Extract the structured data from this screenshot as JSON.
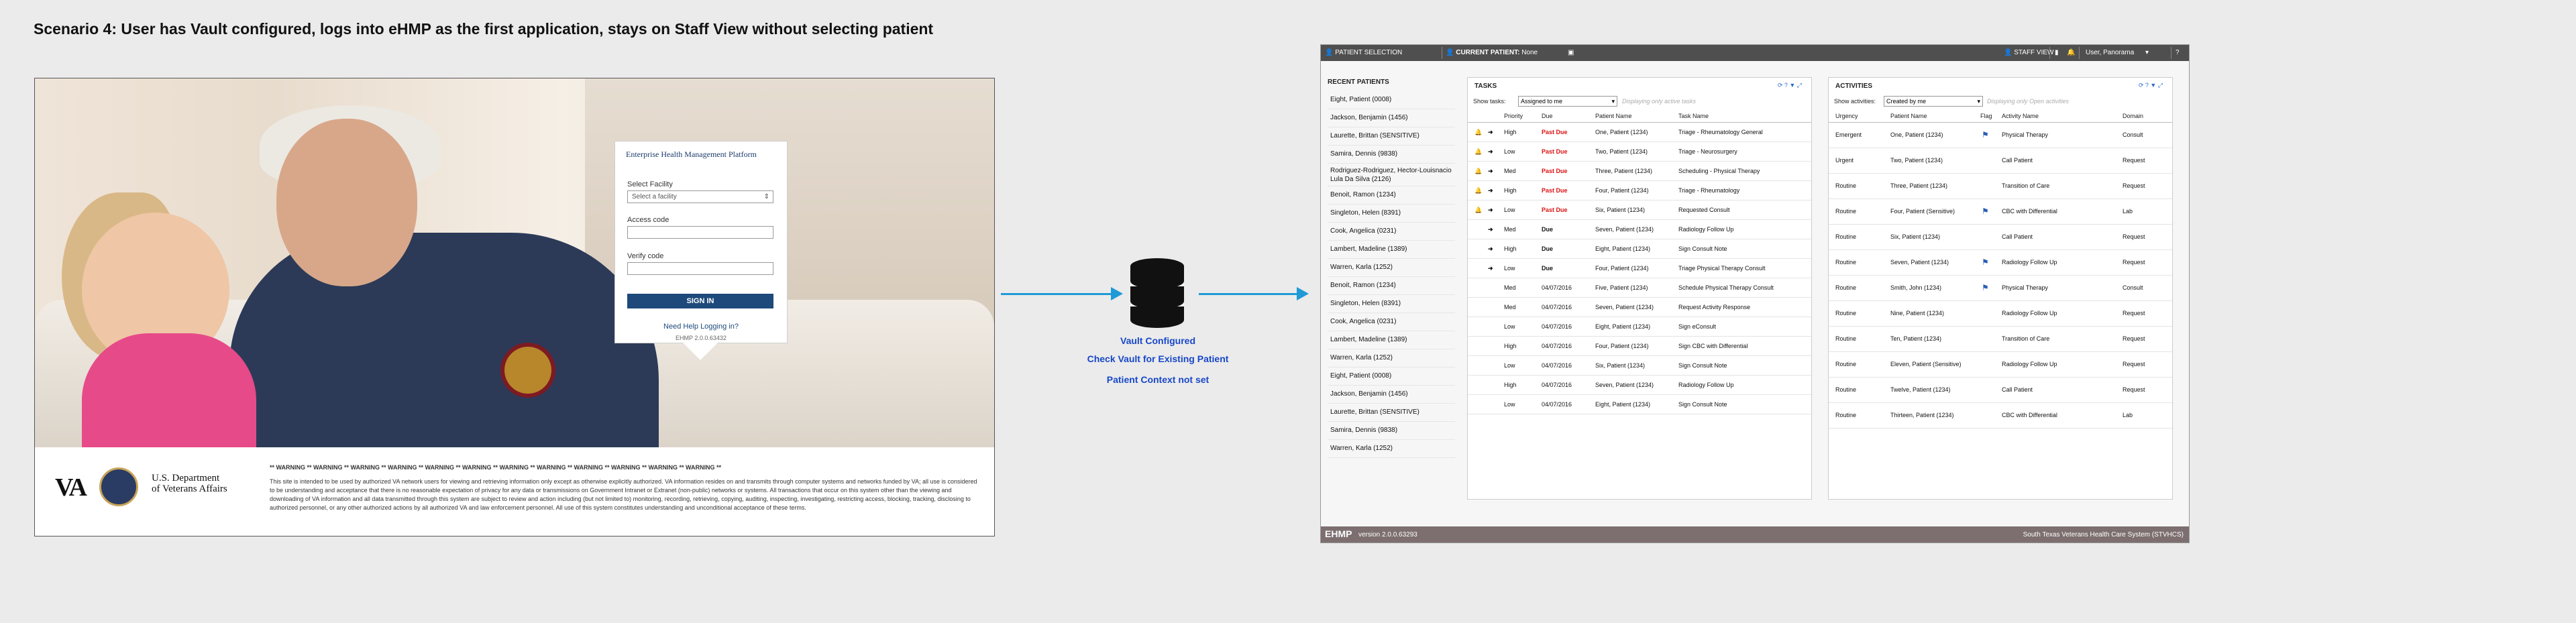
{
  "title": "Scenario 4: User has Vault configured, logs into eHMP as the first application, stays on Staff View without selecting patient",
  "login": {
    "platform_title": "Enterprise Health Management Platform",
    "select_facility_label": "Select Facility",
    "select_facility_value": "Select a facility",
    "access_code_label": "Access code",
    "verify_code_label": "Verify code",
    "sign_in": "SIGN IN",
    "help": "Need Help Logging in?",
    "version": "EHMP 2.0.0.63432",
    "va_logo": "VA",
    "dept_line1": "U.S. Department",
    "dept_line2": "of Veterans Affairs",
    "warning_header": "** WARNING ** WARNING ** WARNING ** WARNING ** WARNING ** WARNING ** WARNING ** WARNING ** WARNING ** WARNING ** WARNING ** WARNING **",
    "warning_text": "This site is intended to be used by authorized VA network users for viewing and retrieving information only except as otherwise explicitly authorized. VA information resides on and transmits through computer systems and networks funded by VA; all use is considered to be understanding and acceptance that there is no reasonable expectation of privacy for any data or transmissions on Government Intranet or Extranet (non-public) networks or systems. All transactions that occur on this system other than the viewing and downloading of VA information and all data transmitted through this system are subject to review and action including (but not limited to) monitoring, recording, retrieving, copying, auditing, inspecting, investigating, restricting access, blocking, tracking, disclosing to authorized personnel, or any other authorized actions by all authorized VA and law enforcement personnel. All use of this system constitutes understanding and unconditional acceptance of these terms."
  },
  "flow": {
    "line1": "Vault Configured",
    "line2": "Check Vault for Existing Patient",
    "line3": "Patient Context not set"
  },
  "app": {
    "patient_selection": "PATIENT SELECTION",
    "current_patient_label": "CURRENT PATIENT:",
    "current_patient_value": "None",
    "staff_view": "STAFF VIEW",
    "user": "User, Panorama",
    "footer_brand": "EHMP",
    "footer_version": "version 2.0.0.63293",
    "footer_site": "South Texas Veterans Health Care System (STVHCS)",
    "recent_title": "RECENT PATIENTS",
    "recent_patients": [
      "Eight, Patient (0008)",
      "Jackson, Benjamin (1456)",
      "Laurette, Brittan (SENSITIVE)",
      "Samira, Dennis (9838)",
      "Rodriguez-Rodriguez, Hector-Louisnacio Lula Da Silva (2126)",
      "Benoit, Ramon (1234)",
      "Singleton, Helen (8391)",
      "Cook, Angelica (0231)",
      "Lambert, Madeline (1389)",
      "Warren, Karla (1252)",
      "Benoit, Ramon (1234)",
      "Singleton, Helen (8391)",
      "Cook, Angelica (0231)",
      "Lambert, Madeline (1389)",
      "Warren, Karla (1252)",
      "Eight, Patient (0008)",
      "Jackson, Benjamin (1456)",
      "Laurette, Brittan (SENSITIVE)",
      "Samira, Dennis (9838)",
      "Warren, Karla (1252)"
    ],
    "tasks": {
      "title": "TASKS",
      "show_label": "Show tasks:",
      "show_value": "Assigned to me",
      "hint": "Displaying only active tasks",
      "columns": [
        "Priority",
        "Due",
        "Patient Name",
        "Task Name"
      ],
      "rows": [
        {
          "bell": true,
          "arrow": true,
          "priority": "High",
          "due": "Past Due",
          "due_style": "past",
          "patient": "One, Patient (1234)",
          "task": "Triage - Rheumatology General"
        },
        {
          "bell": true,
          "arrow": true,
          "priority": "Low",
          "due": "Past Due",
          "due_style": "past",
          "patient": "Two, Patient (1234)",
          "task": "Triage - Neurosurgery"
        },
        {
          "bell": true,
          "arrow": true,
          "priority": "Med",
          "due": "Past Due",
          "due_style": "past",
          "patient": "Three, Patient (1234)",
          "task": "Scheduling - Physical Therapy"
        },
        {
          "bell": true,
          "arrow": true,
          "priority": "High",
          "due": "Past Due",
          "due_style": "past",
          "patient": "Four, Patient (1234)",
          "task": "Triage - Rheumatology"
        },
        {
          "bell": true,
          "arrow": true,
          "priority": "Low",
          "due": "Past Due",
          "due_style": "past",
          "patient": "Six, Patient (1234)",
          "task": "Requested Consult"
        },
        {
          "bell": false,
          "arrow": true,
          "priority": "Med",
          "due": "Due",
          "due_style": "due",
          "patient": "Seven, Patient (1234)",
          "task": "Radiology Follow Up"
        },
        {
          "bell": false,
          "arrow": true,
          "priority": "High",
          "due": "Due",
          "due_style": "due",
          "patient": "Eight, Patient (1234)",
          "task": "Sign Consult Note"
        },
        {
          "bell": false,
          "arrow": true,
          "priority": "Low",
          "due": "Due",
          "due_style": "due",
          "patient": "Four, Patient (1234)",
          "task": "Triage Physical Therapy Consult"
        },
        {
          "bell": false,
          "arrow": false,
          "priority": "Med",
          "due": "04/07/2016",
          "due_style": "",
          "patient": "Five, Patient (1234)",
          "task": "Schedule Physical Therapy Consult"
        },
        {
          "bell": false,
          "arrow": false,
          "priority": "Med",
          "due": "04/07/2016",
          "due_style": "",
          "patient": "Seven, Patient (1234)",
          "task": "Request Activity Response"
        },
        {
          "bell": false,
          "arrow": false,
          "priority": "Low",
          "due": "04/07/2016",
          "due_style": "",
          "patient": "Eight, Patient (1234)",
          "task": "Sign eConsult"
        },
        {
          "bell": false,
          "arrow": false,
          "priority": "High",
          "due": "04/07/2016",
          "due_style": "",
          "patient": "Four, Patient (1234)",
          "task": "Sign CBC with Differential"
        },
        {
          "bell": false,
          "arrow": false,
          "priority": "Low",
          "due": "04/07/2016",
          "due_style": "",
          "patient": "Six, Patient (1234)",
          "task": "Sign Consult Note"
        },
        {
          "bell": false,
          "arrow": false,
          "priority": "High",
          "due": "04/07/2016",
          "due_style": "",
          "patient": "Seven, Patient (1234)",
          "task": "Radiology Follow Up"
        },
        {
          "bell": false,
          "arrow": false,
          "priority": "Low",
          "due": "04/07/2016",
          "due_style": "",
          "patient": "Eight, Patient (1234)",
          "task": "Sign Consult Note"
        }
      ]
    },
    "activities": {
      "title": "ACTIVITIES",
      "show_label": "Show activities:",
      "show_value": "Created by me",
      "hint": "Displaying only Open activities",
      "columns": [
        "Urgency",
        "Patient Name",
        "Flag",
        "Activity Name",
        "Domain"
      ],
      "rows": [
        {
          "urgency": "Emergent",
          "patient": "One, Patient (1234)",
          "flag": true,
          "activity": "Physical Therapy",
          "domain": "Consult"
        },
        {
          "urgency": "Urgent",
          "patient": "Two, Patient (1234)",
          "flag": false,
          "activity": "Call Patient",
          "domain": "Request"
        },
        {
          "urgency": "Routine",
          "patient": "Three, Patient (1234)",
          "flag": false,
          "activity": "Transition of Care",
          "domain": "Request"
        },
        {
          "urgency": "Routine",
          "patient": "Four, Patient (Sensitive)",
          "flag": true,
          "activity": "CBC with Differential",
          "domain": "Lab"
        },
        {
          "urgency": "Routine",
          "patient": "Six, Patient (1234)",
          "flag": false,
          "activity": "Call Patient",
          "domain": "Request"
        },
        {
          "urgency": "Routine",
          "patient": "Seven, Patient (1234)",
          "flag": true,
          "activity": "Radiology Follow Up",
          "domain": "Request"
        },
        {
          "urgency": "Routine",
          "patient": "Smith, John (1234)",
          "flag": true,
          "activity": "Physical Therapy",
          "domain": "Consult"
        },
        {
          "urgency": "Routine",
          "patient": "Nine, Patient (1234)",
          "flag": false,
          "activity": "Radiology Follow Up",
          "domain": "Request"
        },
        {
          "urgency": "Routine",
          "patient": "Ten, Patient (1234)",
          "flag": false,
          "activity": "Transition of Care",
          "domain": "Request"
        },
        {
          "urgency": "Routine",
          "patient": "Eleven, Patient (Sensitive)",
          "flag": false,
          "activity": "Radiology Follow Up",
          "domain": "Request"
        },
        {
          "urgency": "Routine",
          "patient": "Twelve, Patient (1234)",
          "flag": false,
          "activity": "Call Patient",
          "domain": "Request"
        },
        {
          "urgency": "Routine",
          "patient": "Thirteen, Patient (1234)",
          "flag": false,
          "activity": "CBC with Differential",
          "domain": "Lab"
        }
      ]
    }
  },
  "colors": {
    "flow_blue": "#1f9ad6",
    "flow_text": "#1747c8",
    "past_due": "#dd1111",
    "bell": "#e0a21c",
    "flag": "#2a5db8",
    "topbar": "#4f4f4f",
    "footerbar": "#7d6f70"
  }
}
